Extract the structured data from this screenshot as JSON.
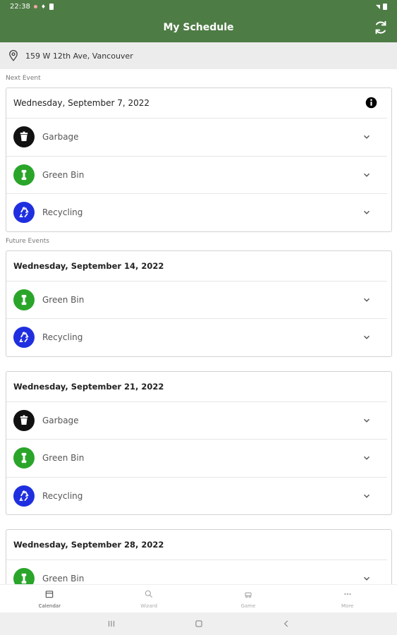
{
  "status_bar": {
    "time": "22:38"
  },
  "app_bar": {
    "title": "My Schedule"
  },
  "location": {
    "address": "159 W 12th Ave, Vancouver"
  },
  "sections": {
    "next_label": "Next Event",
    "future_label": "Future Events"
  },
  "next_event": {
    "date": "Wednesday, September 7, 2022",
    "items": [
      {
        "label": "Garbage",
        "type": "garbage"
      },
      {
        "label": "Green Bin",
        "type": "green"
      },
      {
        "label": "Recycling",
        "type": "recycling"
      }
    ]
  },
  "future_events": [
    {
      "date": "Wednesday, September 14, 2022",
      "items": [
        {
          "label": "Green Bin",
          "type": "green"
        },
        {
          "label": "Recycling",
          "type": "recycling"
        }
      ]
    },
    {
      "date": "Wednesday, September 21, 2022",
      "items": [
        {
          "label": "Garbage",
          "type": "garbage"
        },
        {
          "label": "Green Bin",
          "type": "green"
        },
        {
          "label": "Recycling",
          "type": "recycling"
        }
      ]
    },
    {
      "date": "Wednesday, September 28, 2022",
      "items": [
        {
          "label": "Green Bin",
          "type": "green"
        }
      ]
    }
  ],
  "bottom_nav": [
    {
      "label": "Calendar",
      "icon": "calendar-icon",
      "active": true
    },
    {
      "label": "Wizard",
      "icon": "search-icon",
      "active": false
    },
    {
      "label": "Game",
      "icon": "game-icon",
      "active": false
    },
    {
      "label": "More",
      "icon": "more-icon",
      "active": false
    }
  ],
  "colors": {
    "brand": "#4e7c45",
    "garbage": "#111111",
    "green": "#2aa52a",
    "recycling": "#1f2fe0"
  }
}
